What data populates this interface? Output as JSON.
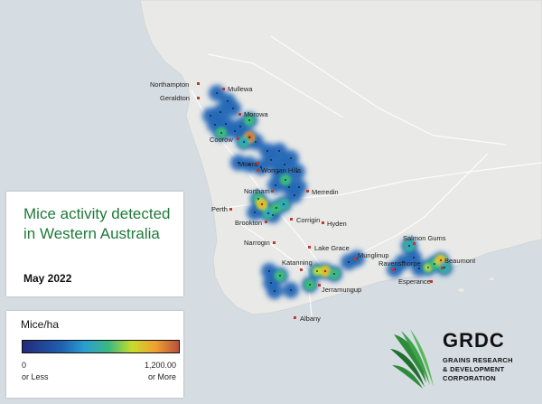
{
  "title": "Mice activity detected in Western Australia",
  "subtitle": "May 2022",
  "legend": {
    "title": "Mice/ha",
    "min_value": "0",
    "min_note": "or Less",
    "max_value": "1,200.00",
    "max_note": "or More",
    "colors": [
      "#232a7a",
      "#2060b0",
      "#2a9fd0",
      "#3cb880",
      "#c8dc2a",
      "#f0a030",
      "#b8503c"
    ]
  },
  "logo": {
    "name": "GRDC",
    "line1": "GRAINS RESEARCH",
    "line2": "& DEVELOPMENT",
    "line3": "CORPORATION"
  },
  "colors": {
    "land": "#e9e9e7",
    "sea": "#d6dde2",
    "title_green": "#1f7a3a",
    "town_marker": "#c0392b"
  },
  "towns": [
    "Northampton",
    "Geraldton",
    "Mullewa",
    "Morowa",
    "Coorow",
    "Moora",
    "Wongan Hills",
    "Northam",
    "Merredin",
    "Perth",
    "Brookton",
    "Corrigin",
    "Hyden",
    "Narrogin",
    "Lake Grace",
    "Katanning",
    "Munglinup",
    "Jerramungup",
    "Albany",
    "Salmon Gums",
    "Ravensthorpe",
    "Beaumont",
    "Esperance"
  ]
}
